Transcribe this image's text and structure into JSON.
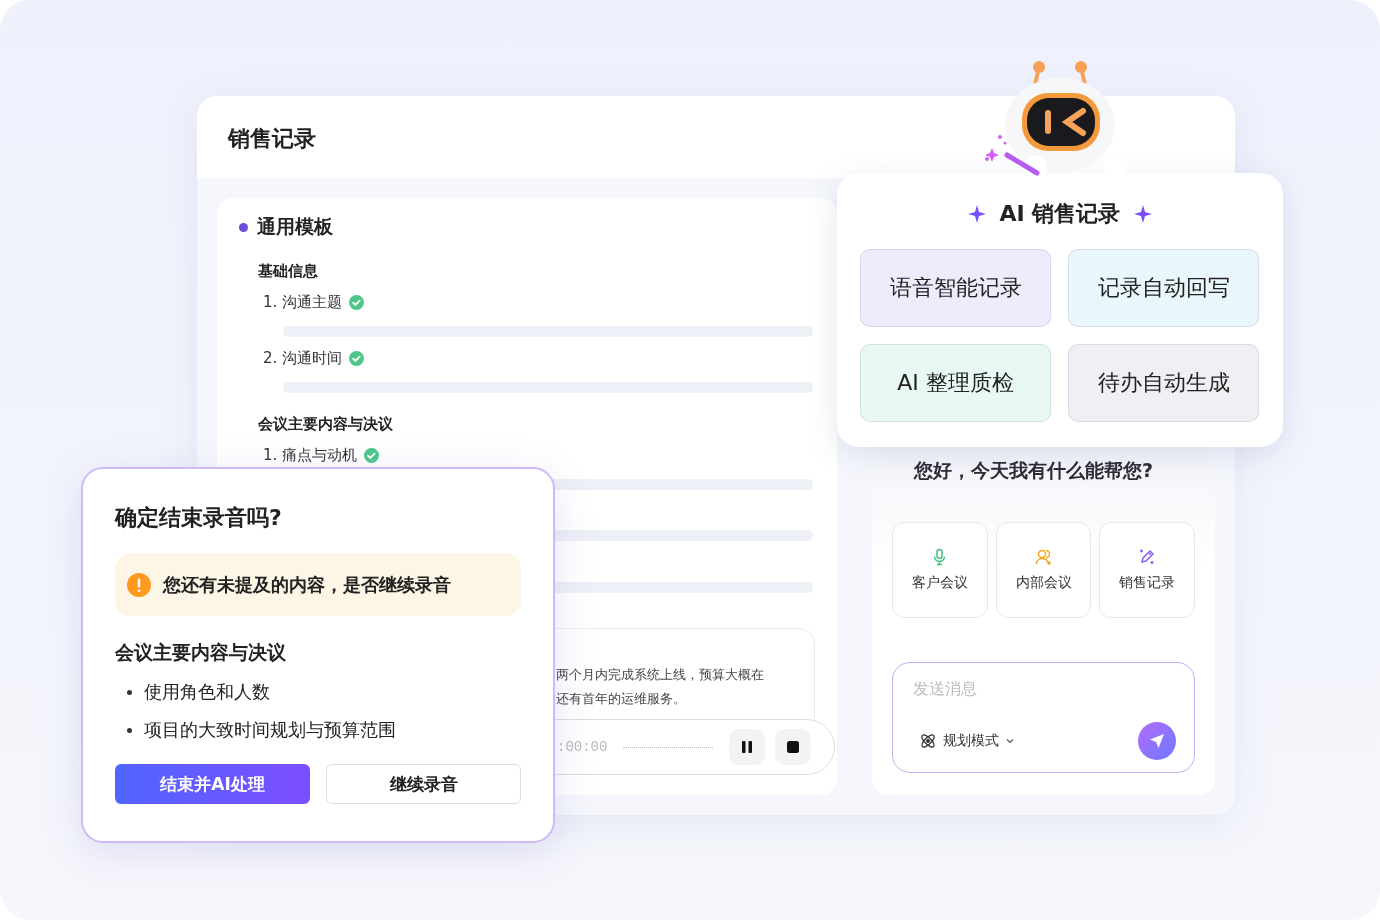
{
  "app_window": {
    "title": "销售记录"
  },
  "template": {
    "heading": "通用模板",
    "sections": [
      {
        "title": "基础信息",
        "items": [
          {
            "label": "1. 沟通主题",
            "checked": true
          },
          {
            "label": "2. 沟通时间",
            "checked": true
          }
        ]
      },
      {
        "title": "会议主要内容与决议",
        "items": [
          {
            "label": "1. 痛点与动机",
            "checked": true
          }
        ]
      }
    ]
  },
  "transcript": {
    "lines": [
      "两个月内完成系统上线，预算大概在",
      "还有首年的运维服务。"
    ]
  },
  "recorder": {
    "time": ":00:00"
  },
  "ai_card": {
    "title": "AI 销售记录",
    "features": [
      {
        "label": "语音智能记录",
        "color": "#efeafc"
      },
      {
        "label": "记录自动回写",
        "color": "#e9f6fc"
      },
      {
        "label": "AI 整理质检",
        "color": "#e8f8f2"
      },
      {
        "label": "待办自动生成",
        "color": "#f0f0f4"
      }
    ]
  },
  "assistant": {
    "greeting": "您好，今天我有什么能帮您?",
    "shortcuts": [
      {
        "label": "客户会议",
        "kind": "mic"
      },
      {
        "label": "内部会议",
        "kind": "people"
      },
      {
        "label": "销售记录",
        "kind": "pen"
      }
    ],
    "input": {
      "placeholder": "发送消息"
    },
    "mode": "规划模式"
  },
  "dialog": {
    "title": "确定结束录音吗?",
    "alert": "您还有未提及的内容，是否继续录音",
    "section": "会议主要内容与决议",
    "bullets": [
      "使用角色和人数",
      "项目的大致时间规划与预算范围"
    ],
    "buttons": [
      {
        "label": "结束并AI处理",
        "kind": "primary"
      },
      {
        "label": "继续录音",
        "kind": "secondary"
      }
    ]
  }
}
